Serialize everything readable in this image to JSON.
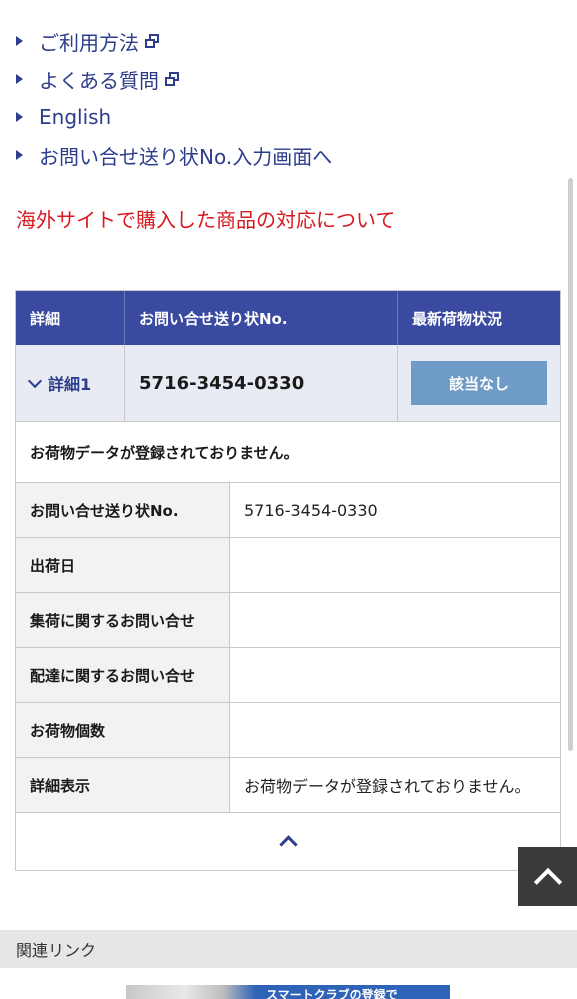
{
  "links": [
    {
      "label": "ご利用方法",
      "external": true
    },
    {
      "label": "よくある質問",
      "external": true
    },
    {
      "label": "English",
      "external": false
    },
    {
      "label": "お問い合せ送り状No.入力画面へ",
      "external": false
    }
  ],
  "notice": "海外サイトで購入した商品の対応について",
  "tracking": {
    "headers": {
      "detail": "詳細",
      "invoice_no": "お問い合せ送り状No.",
      "latest_status": "最新荷物状況"
    },
    "row": {
      "detail_label": "詳細1",
      "invoice_no": "5716-3454-0330",
      "status_button": "該当なし"
    },
    "message": "お荷物データが登録されておりません。",
    "details": [
      {
        "label": "お問い合せ送り状No.",
        "value": "5716-3454-0330"
      },
      {
        "label": "出荷日",
        "value": ""
      },
      {
        "label": "集荷に関するお問い合せ",
        "value": ""
      },
      {
        "label": "配達に関するお問い合せ",
        "value": ""
      },
      {
        "label": "お荷物個数",
        "value": ""
      },
      {
        "label": "詳細表示",
        "value": "お荷物データが登録されておりません。"
      }
    ]
  },
  "related": {
    "title": "関連リンク",
    "banner_text": "スマートクラブの登録で"
  },
  "colors": {
    "link": "#2d3d8c",
    "notice": "#d71920",
    "header_bg": "#3a4aa0",
    "status_button": "#6f9cc6"
  }
}
